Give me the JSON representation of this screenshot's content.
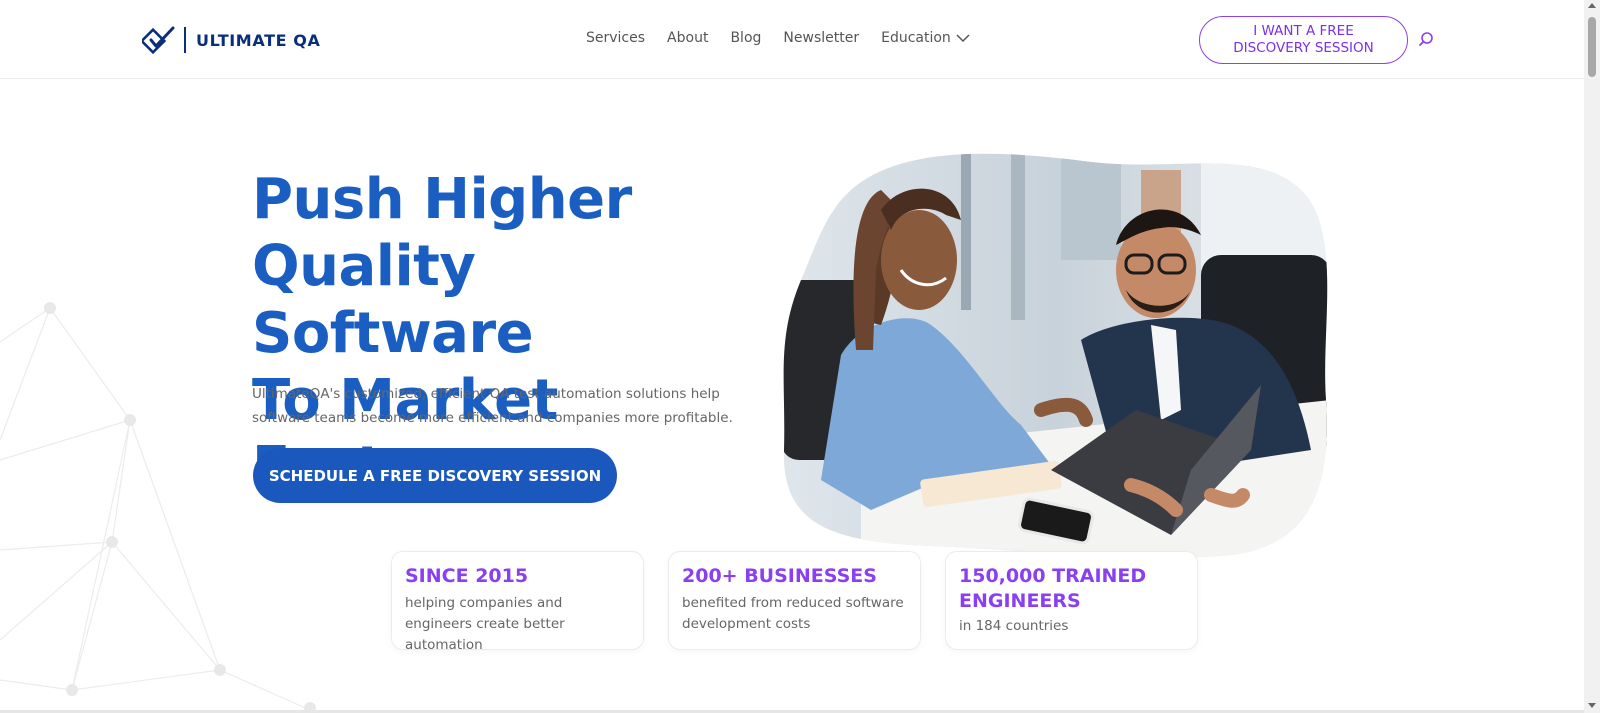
{
  "header": {
    "logo_text": "ULTIMATE QA",
    "nav": [
      {
        "label": "Services"
      },
      {
        "label": "About"
      },
      {
        "label": "Blog"
      },
      {
        "label": "Newsletter"
      },
      {
        "label": "Education",
        "has_dropdown": true
      }
    ],
    "cta_label": "I WANT A FREE DISCOVERY SESSION",
    "search_icon": "search-icon"
  },
  "hero": {
    "title_line1": "Push Higher",
    "title_line2": "Quality Software",
    "title_line3": "To Market Faster",
    "description": "UltimateQA's customized, efficient QA test automation solutions help software teams become more efficient and companies more profitable.",
    "cta_label": "SCHEDULE A FREE DISCOVERY SESSION",
    "image_icon": "team-photo"
  },
  "stats": [
    {
      "title": "SINCE 2015",
      "description": "helping companies and engineers create better automation"
    },
    {
      "title": "200+ BUSINESSES",
      "description": "benefited from reduced software development costs"
    },
    {
      "title": "150,000 TRAINED ENGINEERS",
      "description": "in 184 countries"
    }
  ],
  "colors": {
    "brand_blue": "#1a5ec2",
    "accent_purple": "#8a3ff0",
    "logo_navy": "#0a2f7a"
  }
}
